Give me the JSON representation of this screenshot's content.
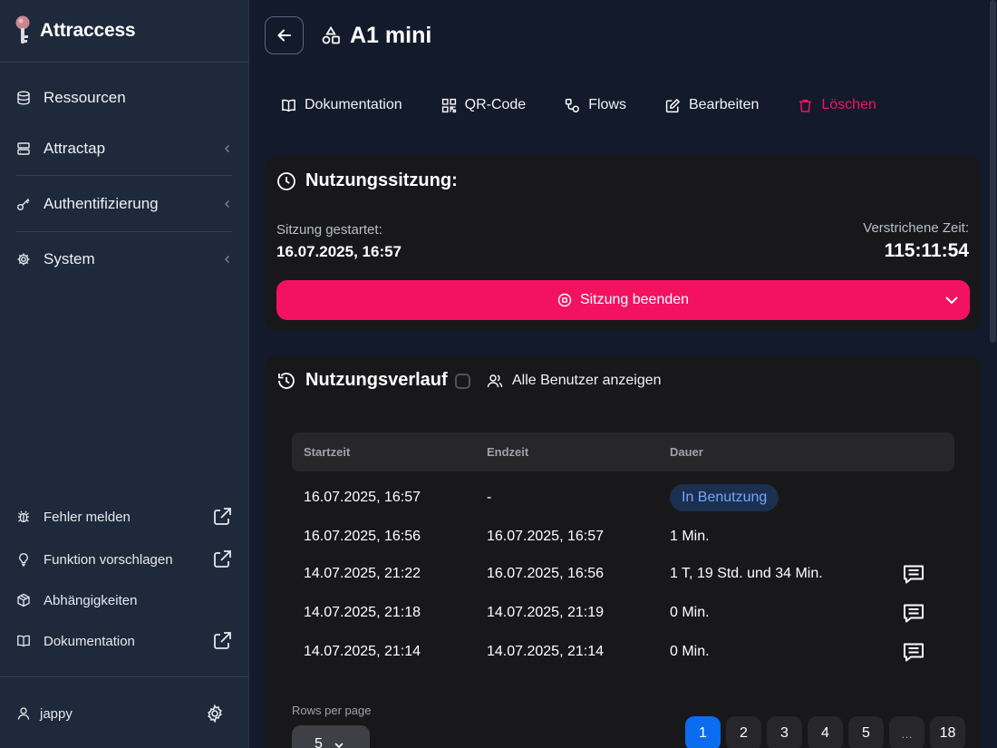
{
  "app": {
    "name": "Attraccess"
  },
  "sidebar": {
    "nav": [
      {
        "label": "Ressourcen"
      },
      {
        "label": "Attractap"
      },
      {
        "label": "Authentifizierung"
      },
      {
        "label": "System"
      }
    ],
    "bottom": [
      {
        "label": "Fehler melden"
      },
      {
        "label": "Funktion vorschlagen"
      },
      {
        "label": "Abhängigkeiten"
      },
      {
        "label": "Dokumentation"
      }
    ],
    "user": {
      "name": "jappy"
    }
  },
  "header": {
    "title": "A1 mini"
  },
  "toolbar": {
    "documentation": "Dokumentation",
    "qrcode": "QR-Code",
    "flows": "Flows",
    "edit": "Bearbeiten",
    "delete": "Löschen"
  },
  "session": {
    "title": "Nutzungssitzung:",
    "started_label": "Sitzung gestartet:",
    "started_value": "16.07.2025, 16:57",
    "elapsed_label": "Verstrichene Zeit:",
    "elapsed_value": "115:11:54",
    "end_button": "Sitzung beenden"
  },
  "history": {
    "title": "Nutzungsverlauf",
    "show_all_label": "Alle Benutzer anzeigen",
    "columns": {
      "start": "Startzeit",
      "end": "Endzeit",
      "duration": "Dauer"
    },
    "rows": [
      {
        "start": "16.07.2025, 16:57",
        "end": "-",
        "duration": "In Benutzung"
      },
      {
        "start": "16.07.2025, 16:56",
        "end": "16.07.2025, 16:57",
        "duration": "1 Min."
      },
      {
        "start": "14.07.2025, 21:22",
        "end": "16.07.2025, 16:56",
        "duration": "1 T, 19 Std. und 34 Min."
      },
      {
        "start": "14.07.2025, 21:18",
        "end": "14.07.2025, 21:19",
        "duration": "0 Min."
      },
      {
        "start": "14.07.2025, 21:14",
        "end": "14.07.2025, 21:14",
        "duration": "0 Min."
      }
    ],
    "rows_per_page_label": "Rows per page",
    "rows_per_page_value": "5",
    "pages": [
      "1",
      "2",
      "3",
      "4",
      "5",
      "…",
      "18"
    ],
    "active_page": "1"
  },
  "colors": {
    "sidebar_bg": "#1e293b",
    "main_bg": "#121a2b",
    "card_bg": "#18181b",
    "danger": "#f31260",
    "primary": "#0b6cf0",
    "chip_text": "#6ea8fe"
  }
}
